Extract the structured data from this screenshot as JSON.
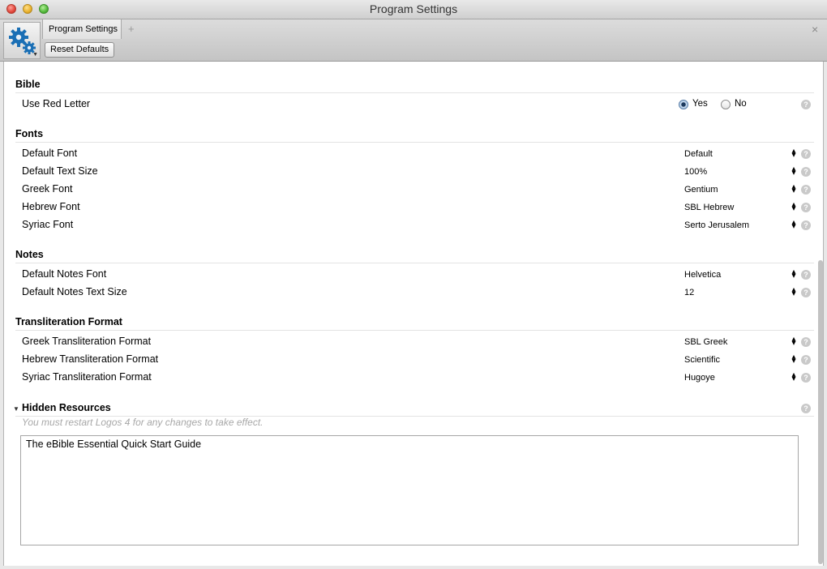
{
  "window": {
    "title": "Program Settings"
  },
  "toolbar": {
    "tab_label": "Program Settings",
    "add_tab": "+",
    "close_tab": "×",
    "reset_label": "Reset Defaults"
  },
  "sections": {
    "bible": {
      "title": "Bible",
      "use_red_letter": {
        "label": "Use Red Letter",
        "yes": "Yes",
        "no": "No",
        "selected": "Yes"
      }
    },
    "fonts": {
      "title": "Fonts",
      "rows": [
        {
          "label": "Default Font",
          "value": "Default"
        },
        {
          "label": "Default Text Size",
          "value": "100%"
        },
        {
          "label": "Greek Font",
          "value": "Gentium"
        },
        {
          "label": "Hebrew Font",
          "value": "SBL Hebrew"
        },
        {
          "label": "Syriac Font",
          "value": "Serto Jerusalem"
        }
      ]
    },
    "notes": {
      "title": "Notes",
      "rows": [
        {
          "label": "Default Notes Font",
          "value": "Helvetica"
        },
        {
          "label": "Default Notes Text Size",
          "value": "12"
        }
      ]
    },
    "transliteration": {
      "title": "Transliteration Format",
      "rows": [
        {
          "label": "Greek Transliteration Format",
          "value": "SBL Greek"
        },
        {
          "label": "Hebrew Transliteration Format",
          "value": "Scientific"
        },
        {
          "label": "Syriac Transliteration Format",
          "value": "Hugoye"
        }
      ]
    },
    "hidden": {
      "title": "Hidden Resources",
      "note": "You must restart Logos 4 for any changes to take effect.",
      "items": [
        "The eBible Essential Quick Start Guide"
      ]
    }
  },
  "icons": {
    "help": "?",
    "updown": "▲▼",
    "disclosure": "▼"
  },
  "colors": {
    "accent": "#1a6fb5",
    "help_bg": "#c9c9c9"
  }
}
